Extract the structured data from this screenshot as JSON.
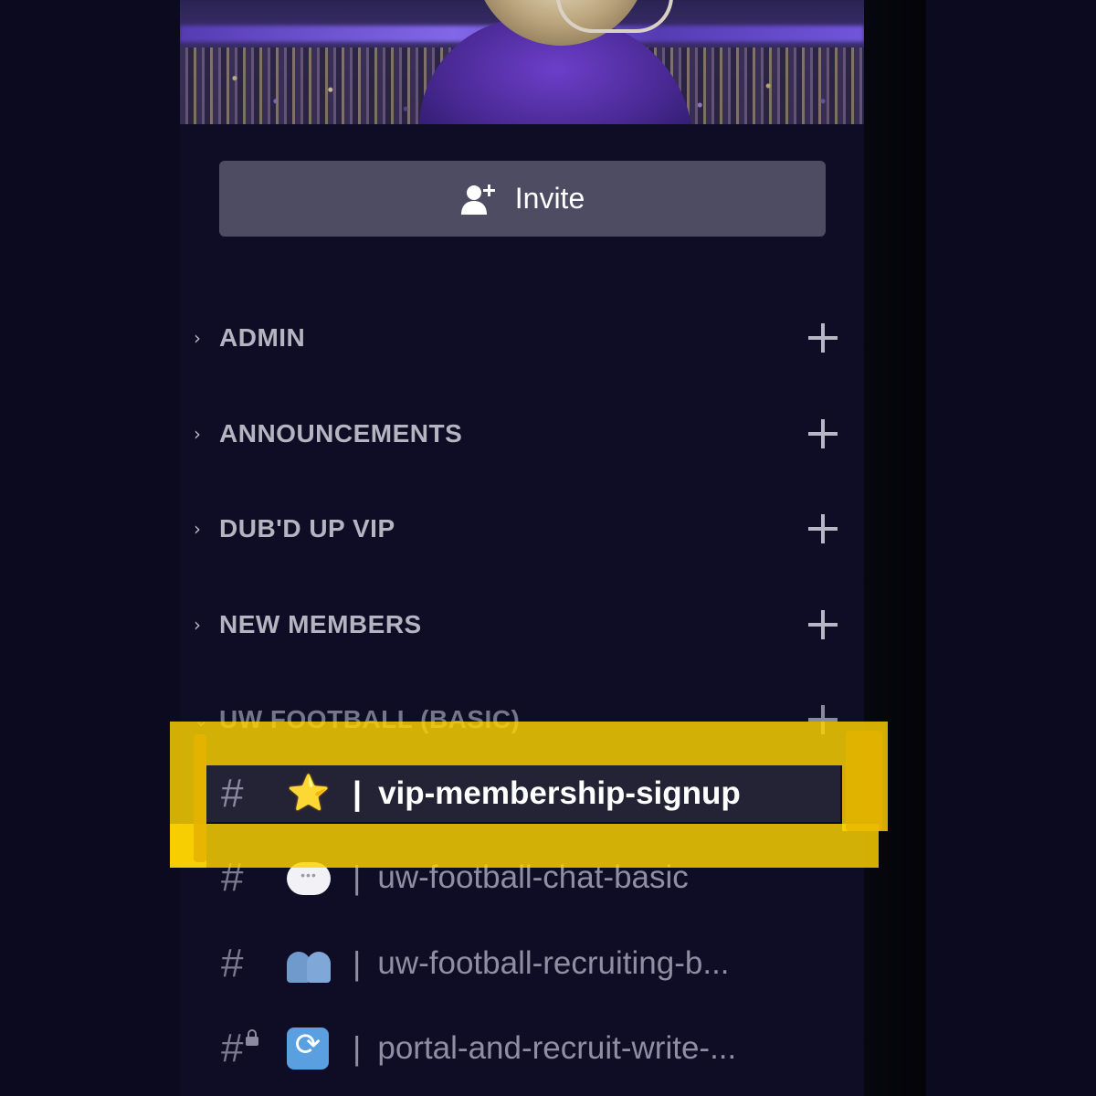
{
  "invite": {
    "label": "Invite",
    "icon": "add-person-icon"
  },
  "categories": [
    {
      "label": "ADMIN",
      "chevron": "›"
    },
    {
      "label": "ANNOUNCEMENTS",
      "chevron": "›"
    },
    {
      "label": "DUB'D UP VIP",
      "chevron": "›"
    },
    {
      "label": "NEW MEMBERS",
      "chevron": "›"
    },
    {
      "label": "UW FOOTBALL (BASIC)",
      "chevron": "⌄"
    }
  ],
  "channels": [
    {
      "hash": "#",
      "emoji": "⭐",
      "separator": "|",
      "name": "vip-membership-signup",
      "active": true
    },
    {
      "hash": "#",
      "emoji": "speech-bubble",
      "separator": "|",
      "name": "uw-football-chat-basic"
    },
    {
      "hash": "#",
      "emoji": "people",
      "separator": "|",
      "name": "uw-football-recruiting-b..."
    },
    {
      "hash": "#",
      "emoji": "cycle-arrows",
      "separator": "|",
      "name": "portal-and-recruit-write-...",
      "locked": true
    }
  ],
  "colors": {
    "background": "#0b0a1e",
    "panel": "#0e0d25",
    "invite_button": "#4e4c63",
    "active_channel": "#242336",
    "highlight": "#ffd400"
  }
}
